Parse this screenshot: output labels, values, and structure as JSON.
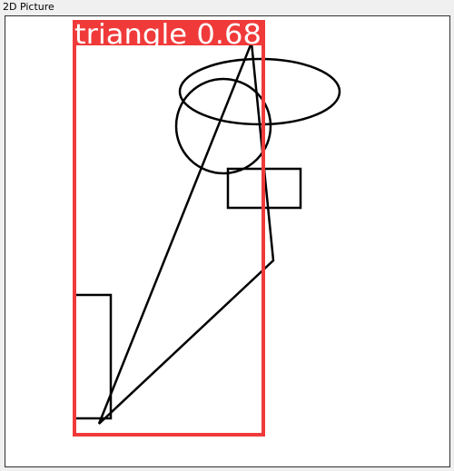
{
  "window": {
    "title": "2D Picture"
  },
  "detection": {
    "label": "triangle 0.68",
    "box_color": "#f03a3a",
    "label_text_color": "#ffffff"
  },
  "drawing": {
    "stroke_color": "#000000",
    "canvas_background": "#ffffff"
  }
}
